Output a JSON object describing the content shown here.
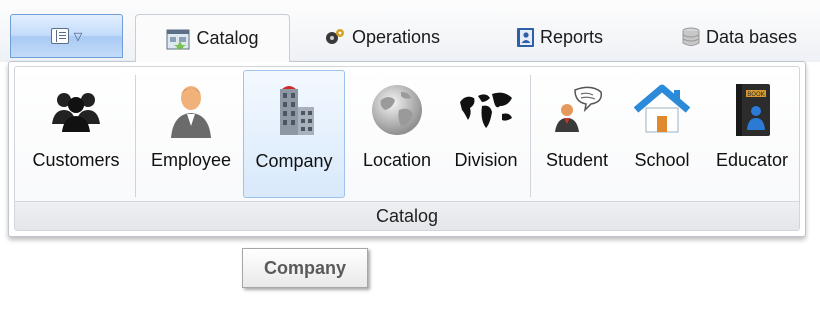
{
  "tabs": {
    "catalog": "Catalog",
    "operations": "Operations",
    "reports": "Reports",
    "databases": "Data bases"
  },
  "ribbon": {
    "group_label": "Catalog",
    "buttons": [
      {
        "label": "Customers",
        "icon": "customers-icon"
      },
      {
        "label": "Employee",
        "icon": "employee-icon"
      },
      {
        "label": "Company",
        "icon": "company-icon",
        "selected": true
      },
      {
        "label": "Location",
        "icon": "globe-icon"
      },
      {
        "label": "Division",
        "icon": "world-map-icon"
      },
      {
        "label": "Student",
        "icon": "student-icon"
      },
      {
        "label": "School",
        "icon": "house-icon"
      },
      {
        "label": "Educator",
        "icon": "book-icon"
      }
    ]
  },
  "tooltip": {
    "text": "Company"
  },
  "colors": {
    "selection": "#d8e9fb",
    "accent": "#6f9fd6"
  }
}
